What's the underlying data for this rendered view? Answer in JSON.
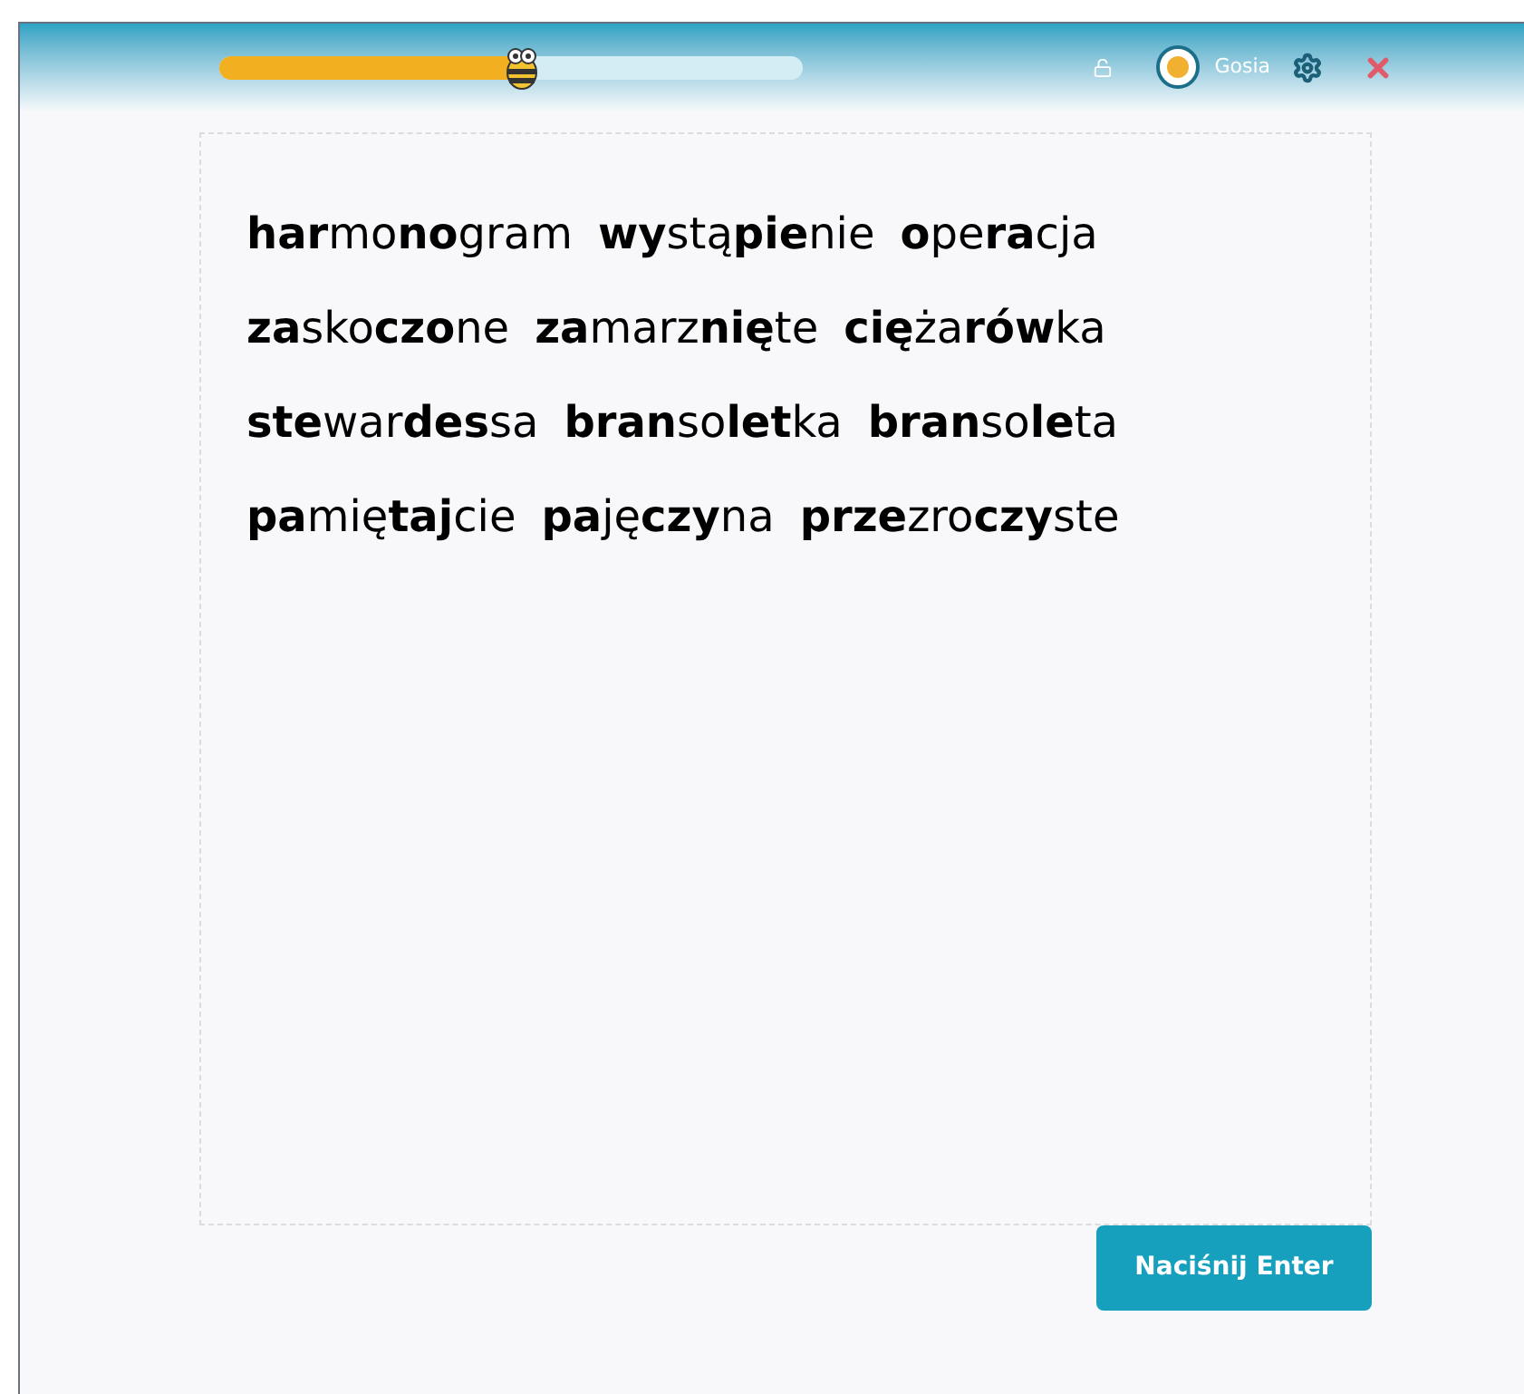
{
  "header": {
    "progress": {
      "level": 0.52
    },
    "user": {
      "name": "Gosia"
    }
  },
  "lines": [
    [
      "**har**mo**no**gram",
      "**wy**stą**pie**nie",
      "**o**pe**ra**cja"
    ],
    [
      "**za**sko**czo**ne",
      "**za**marz**nię**te",
      "**cię**ża**rów**ka"
    ],
    [
      "**ste**war**des**sa",
      "**bran**so**let**ka",
      "**bran**so**le**ta"
    ],
    [
      "**pa**mię**taj**cie",
      "**pa**ję**czy**na",
      "**prze**zro**czy**ste"
    ]
  ],
  "button": {
    "label": "Naciśnij Enter"
  }
}
